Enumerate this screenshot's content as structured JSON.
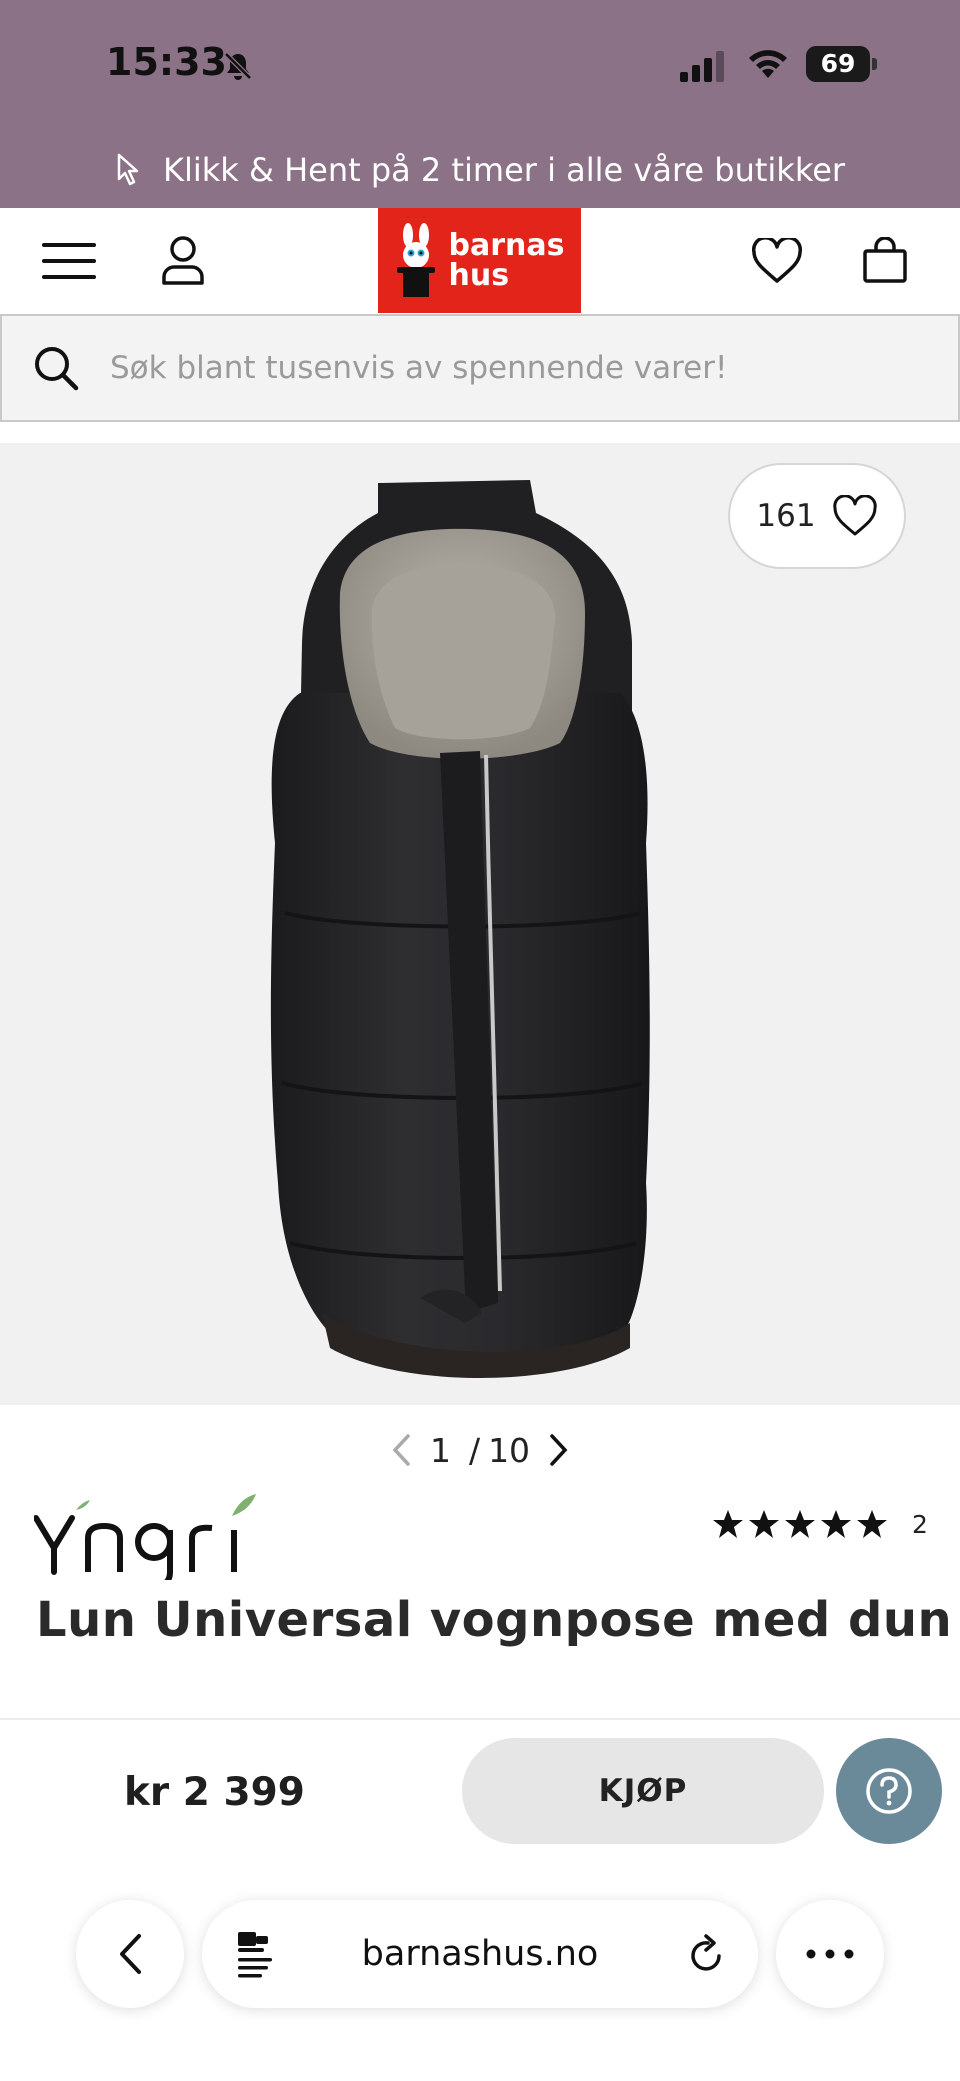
{
  "status_bar": {
    "time": "15:33",
    "battery": "69"
  },
  "promo": {
    "text": "Klikk & Hent på 2 timer i alle våre butikker"
  },
  "header": {
    "logo_line1": "barnas",
    "logo_line2": "hus"
  },
  "search": {
    "placeholder": "Søk blant tusenvis av spennende varer!"
  },
  "product": {
    "likes": "161",
    "pager_current": "1",
    "pager_separator": "/",
    "pager_total": "10",
    "brand": "Yngri",
    "rating_stars": 5,
    "rating_count": "2",
    "title": "Lun Universal vognpose med dun",
    "price": "kr 2 399",
    "buy_label": "KJØP"
  },
  "browser": {
    "url": "barnashus.no"
  },
  "colors": {
    "promo_bg": "#8c7287",
    "logo_red": "#e3241b",
    "help_bg": "#6b8a99"
  }
}
